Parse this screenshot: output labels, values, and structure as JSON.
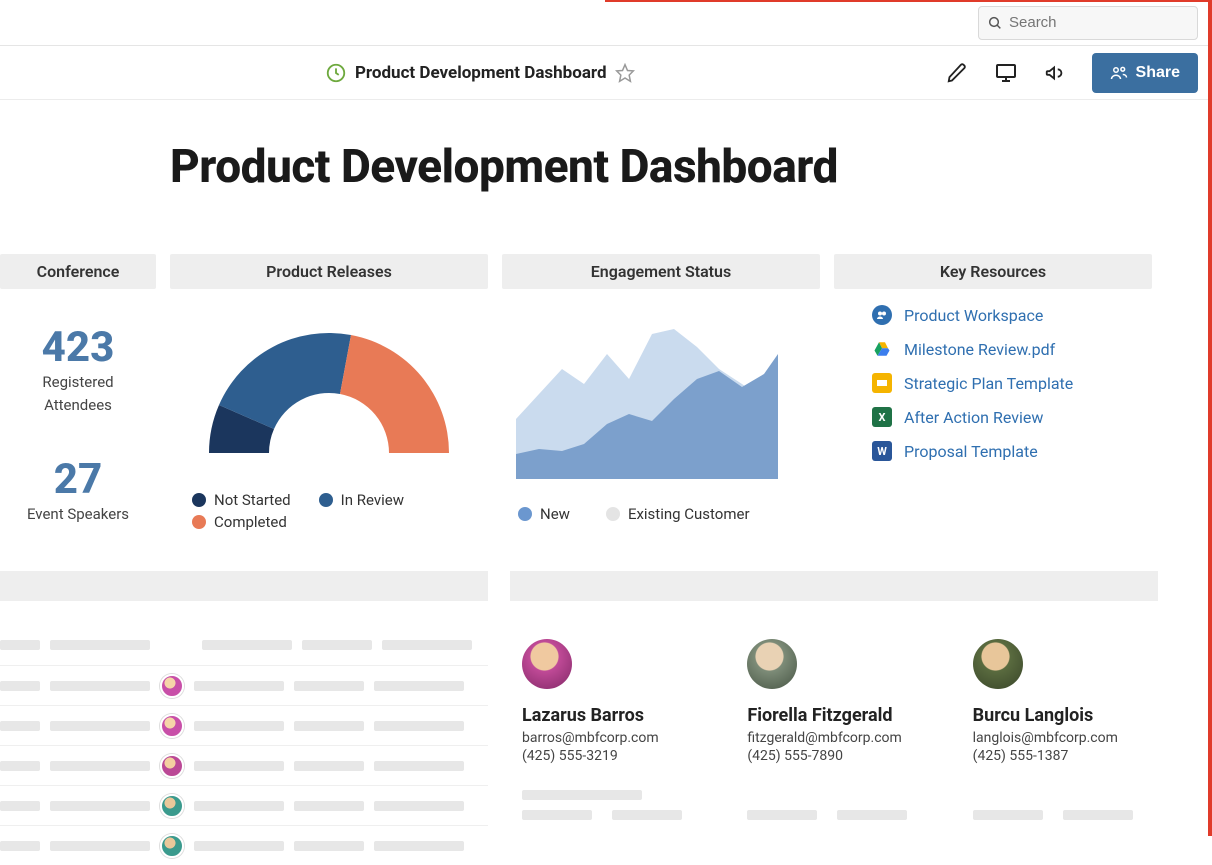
{
  "search": {
    "placeholder": "Search"
  },
  "header": {
    "title": "Product Development Dashboard",
    "share_label": "Share"
  },
  "page": {
    "title": "Product Development Dashboard"
  },
  "widgets": {
    "conference": {
      "title": "Conference",
      "stat1_value": "423",
      "stat1_label_line1": "Registered",
      "stat1_label_line2": "Attendees",
      "stat2_value": "27",
      "stat2_label": "Event Speakers"
    },
    "releases": {
      "title": "Product Releases",
      "legend": {
        "not_started": {
          "label": "Not Started",
          "color": "#1b365d"
        },
        "in_review": {
          "label": "In Review",
          "color": "#2e5e8f"
        },
        "completed": {
          "label": "Completed",
          "color": "#e87a56"
        }
      }
    },
    "engagement": {
      "title": "Engagement Status",
      "legend": {
        "new": {
          "label": "New",
          "color": "#6b97cf"
        },
        "existing": {
          "label": "Existing Customer",
          "color": "#e4e4e4"
        }
      }
    },
    "resources": {
      "title": "Key Resources",
      "items": [
        {
          "label": "Product Workspace",
          "icon_name": "workspace-icon",
          "bg": "#2f6fb0"
        },
        {
          "label": "Milestone Review.pdf",
          "icon_name": "gdrive-icon",
          "bg": "#ffffff"
        },
        {
          "label": "Strategic Plan Template",
          "icon_name": "slides-icon",
          "bg": "#f5b400"
        },
        {
          "label": "After Action Review",
          "icon_name": "excel-icon",
          "bg": "#1f7246"
        },
        {
          "label": "Proposal Template",
          "icon_name": "word-icon",
          "bg": "#2a5699"
        }
      ]
    }
  },
  "contacts": [
    {
      "name": "Lazarus Barros",
      "email": "barros@mbfcorp.com",
      "phone": "(425) 555-3219",
      "avatar_bg": "#d14f9e"
    },
    {
      "name": "Fiorella Fitzgerald",
      "email": "fitzgerald@mbfcorp.com",
      "phone": "(425) 555-7890",
      "avatar_bg": "#8a9787"
    },
    {
      "name": "Burcu Langlois",
      "email": "langlois@mbfcorp.com",
      "phone": "(425) 555-1387",
      "avatar_bg": "#c49a52"
    }
  ],
  "chart_data": [
    {
      "type": "pie",
      "title": "Product Releases",
      "style": "half-donut",
      "series": [
        {
          "name": "Not Started",
          "values": [
            15
          ],
          "color": "#1b365d"
        },
        {
          "name": "In Review",
          "values": [
            45
          ],
          "color": "#2e5e8f"
        },
        {
          "name": "Completed",
          "values": [
            40
          ],
          "color": "#e87a56"
        }
      ]
    },
    {
      "type": "area",
      "title": "Engagement Status",
      "x": [
        0,
        1,
        2,
        3,
        4,
        5,
        6,
        7,
        8,
        9,
        10,
        11,
        12
      ],
      "series": [
        {
          "name": "New",
          "color": "#bed1ea",
          "values": [
            35,
            55,
            75,
            60,
            85,
            62,
            95,
            100,
            85,
            70,
            60,
            50,
            60
          ]
        },
        {
          "name": "Existing Customer",
          "color": "#6b97cf",
          "values": [
            20,
            25,
            22,
            28,
            40,
            48,
            42,
            58,
            70,
            78,
            65,
            75,
            90
          ]
        }
      ],
      "xlabel": "",
      "ylabel": "",
      "ylim": [
        0,
        100
      ]
    }
  ]
}
